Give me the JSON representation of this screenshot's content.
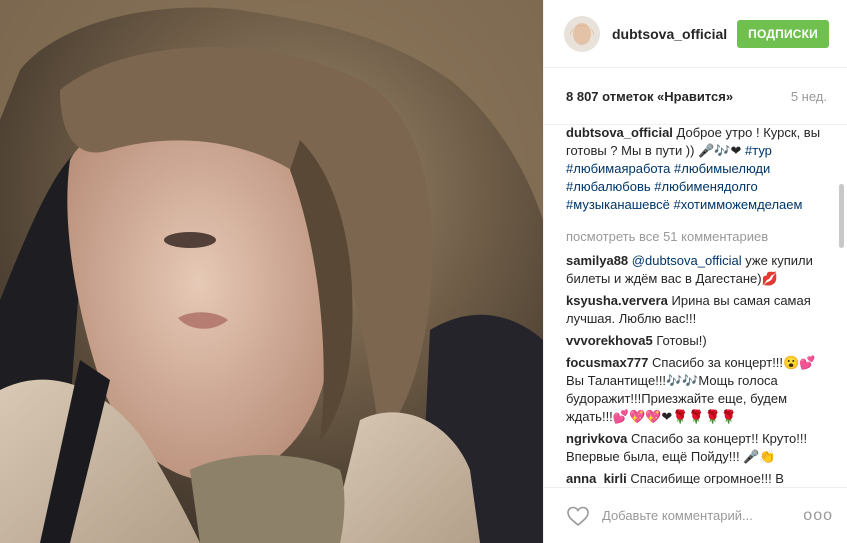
{
  "post": {
    "username": "dubtsova_official",
    "follow_label": "ПОДПИСКИ",
    "likes_text": "8 807 отметок «Нравится»",
    "age": "5 нед.",
    "caption": {
      "username": "dubtsova_official",
      "text": "Доброе утро ! Курск, вы готовы ? Мы в пути )) 🎤🎶❤",
      "tags": [
        "#тур",
        "#любимаяработа",
        "#любимыелюди",
        "#любалюбовь",
        "#любименядолго",
        "#музыканашевсё",
        "#хотимможемделаем"
      ]
    },
    "view_all": "посмотреть все 51 комментариев",
    "comments": [
      {
        "user": "samilya88",
        "mention": "@dubtsova_official",
        "text": "уже купили билеты и ждём вас в Дагестане)💋"
      },
      {
        "user": "ksyusha.ververa",
        "text": "Ирина вы самая самая лучшая. Люблю вас!!!"
      },
      {
        "user": "vvvorekhova5",
        "text": "Готовы!)"
      },
      {
        "user": "focusmax777",
        "text": "Спасибо за концерт!!!😮💕 Вы Талантище!!!🎶🎶Мощь голоса будоражит!!!Приезжайте еще, будем ждать!!!💕💖💖❤🌹🌹🌹🌹"
      },
      {
        "user": "ngrivkova",
        "text": "Спасибо за концерт!! Круто!!! Впервые была, ещё Пойду!!! 🎤👏"
      },
      {
        "user": "anna_kirli",
        "text": "Спасибище огромное!!! В"
      }
    ],
    "add_comment_placeholder": "Добавьте комментарий...",
    "more_symbol": "ooo"
  }
}
